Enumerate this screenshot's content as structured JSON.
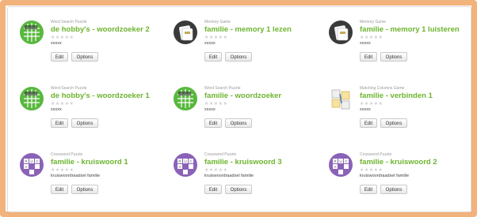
{
  "games": [
    {
      "type": "Word Search Puzzle",
      "title": "de hobby's - woordzoeker 2",
      "stars": "★★★★★",
      "desc": "xxxxx",
      "edit": "Edit",
      "options": "Options",
      "icon": "word-search-icon"
    },
    {
      "type": "Memory Game",
      "title": "familie - memory 1 lezen",
      "stars": "★★★★★",
      "desc": "xxxxx",
      "edit": "Edit",
      "options": "Options",
      "icon": "memory-game-icon"
    },
    {
      "type": "Memory Game",
      "title": "familie - memory 1 luisteren",
      "stars": "★★★★★",
      "desc": "xxxxx",
      "edit": "Edit",
      "options": "Options",
      "icon": "memory-game-icon"
    },
    {
      "type": "Word Search Puzzle",
      "title": "de hobby's - woordzoeker 1",
      "stars": "★★★★★",
      "desc": "xxxxx",
      "edit": "Edit",
      "options": "Options",
      "icon": "word-search-icon"
    },
    {
      "type": "Word Search Puzzle",
      "title": "familie - woordzoeker",
      "stars": "★★★★★",
      "desc": "xxxxx",
      "edit": "Edit",
      "options": "Options",
      "icon": "word-search-icon"
    },
    {
      "type": "Matching Columns Game",
      "title": "familie - verbinden 1",
      "stars": "★★★★★",
      "desc": "xxxxx",
      "edit": "Edit",
      "options": "Options",
      "icon": "matching-columns-icon"
    },
    {
      "type": "Crossword Puzzle",
      "title": "familie - kruiswoord 1",
      "stars": "★★★★★",
      "desc": "kruiswoordraadsel familie",
      "edit": "Edit",
      "options": "Options",
      "icon": "crossword-icon"
    },
    {
      "type": "Crossword Puzzle",
      "title": "familie - kruiswoord 3",
      "stars": "★★★★★",
      "desc": "kruiswoordraadsel familie",
      "edit": "Edit",
      "options": "Options",
      "icon": "crossword-icon"
    },
    {
      "type": "Crossword Puzzle",
      "title": "familie - kruiswoord 2",
      "stars": "★★★★★",
      "desc": "kruiswoordraadsel familie",
      "edit": "Edit",
      "options": "Options",
      "icon": "crossword-icon"
    }
  ],
  "colors": {
    "frame": "#f2b27c",
    "title": "#6db42f",
    "button_border": "#c9c9c9"
  }
}
